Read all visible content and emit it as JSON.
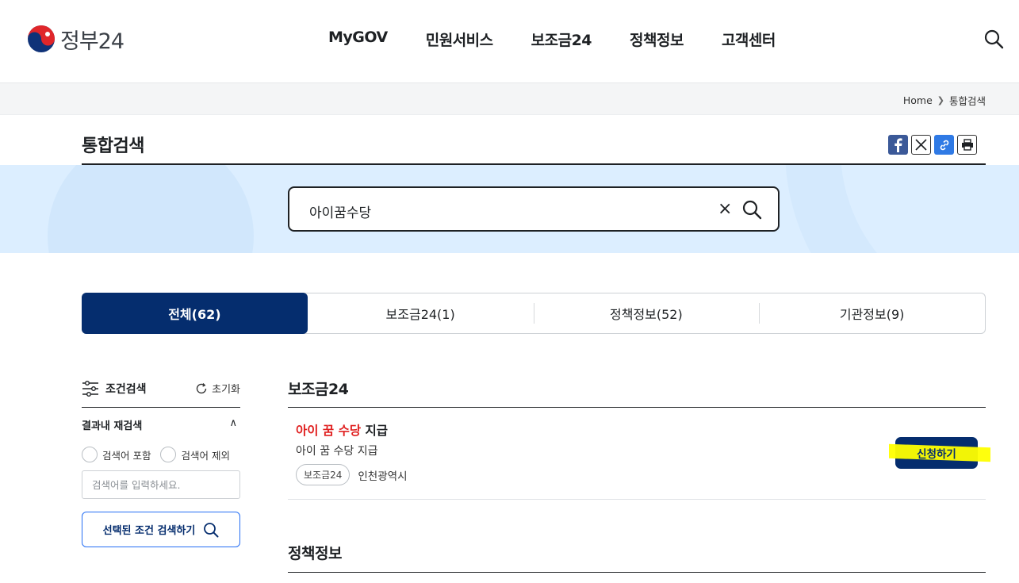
{
  "header": {
    "logo_text": "정부24",
    "nav": [
      "MyGOV",
      "민원서비스",
      "보조금24",
      "정책정보",
      "고객센터"
    ]
  },
  "breadcrumb": {
    "home": "Home",
    "current": "통합검색"
  },
  "page": {
    "title": "통합검색"
  },
  "share": [
    "facebook-icon",
    "x-icon",
    "link-icon",
    "print-icon"
  ],
  "search": {
    "value": "아이꿈수당",
    "clear": "×"
  },
  "tabs": [
    {
      "label": "전체(62)",
      "active": true
    },
    {
      "label": "보조금24(1)",
      "active": false
    },
    {
      "label": "정책정보(52)",
      "active": false
    },
    {
      "label": "기관정보(9)",
      "active": false
    }
  ],
  "filter": {
    "title": "조건검색",
    "reset": "초기화",
    "sub_title": "결과내 재검색",
    "include_label": "검색어 포함",
    "exclude_label": "검색어 제외",
    "input_placeholder": "검색어를 입력하세요.",
    "submit_label": "선택된 조건 검색하기"
  },
  "sections": {
    "subsidy_title": "보조금24",
    "policy_title": "정책정보"
  },
  "result": {
    "title_highlight": "아이 꿈 수당",
    "title_rest": " 지급",
    "description": "아이 꿈 수당 지급",
    "tag": "보조금24",
    "region": "인천광역시",
    "apply_label": "신청하기"
  },
  "colors": {
    "primary": "#052d6e",
    "highlight": "#e02020",
    "marker": "#ffff00",
    "band": "#dceeff"
  }
}
